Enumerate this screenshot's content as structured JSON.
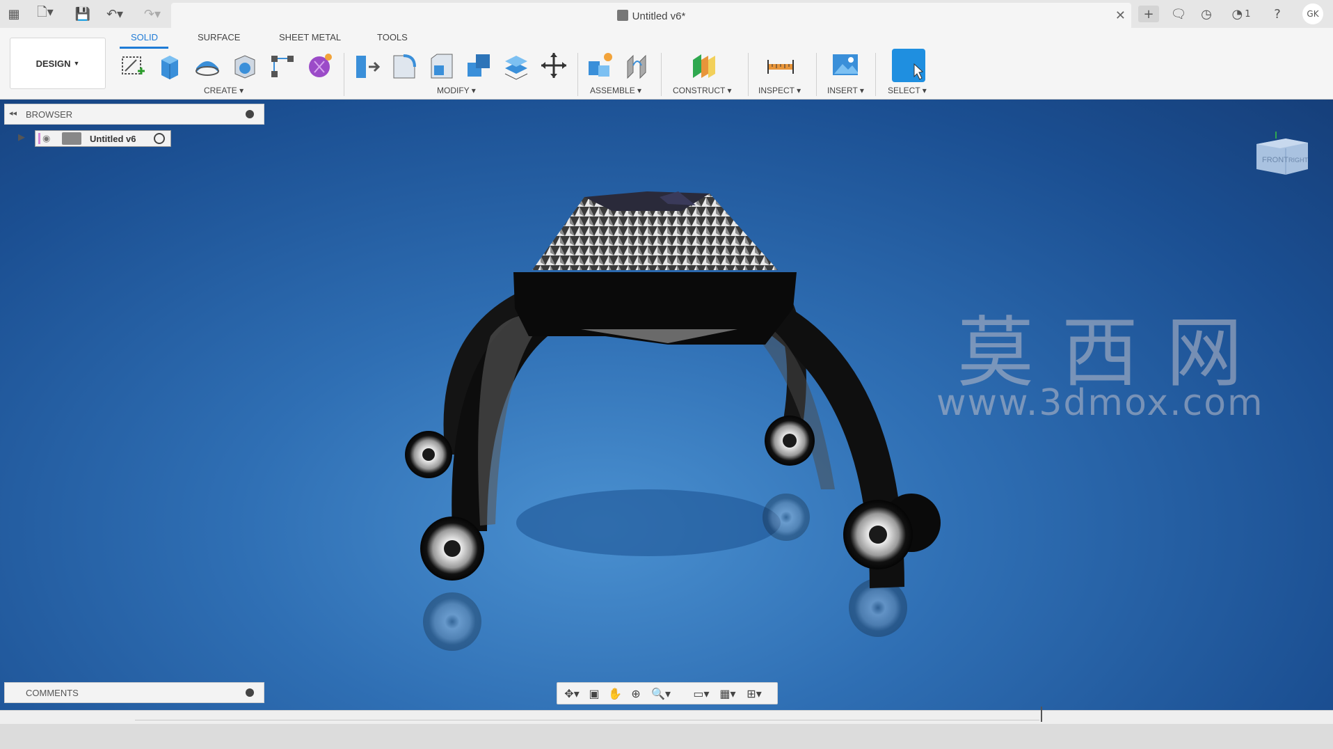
{
  "window": {
    "title": "Untitled v6*"
  },
  "toolbar": {
    "workspace": "DESIGN",
    "tabs": [
      "SOLID",
      "SURFACE",
      "SHEET METAL",
      "TOOLS"
    ],
    "groups": [
      "CREATE",
      "MODIFY",
      "ASSEMBLE",
      "CONSTRUCT",
      "INSPECT",
      "INSERT",
      "SELECT"
    ]
  },
  "header": {
    "jobs_count": "1",
    "user_initials": "GK"
  },
  "browser": {
    "title": "BROWSER",
    "root_component": "Untitled v6"
  },
  "comments": {
    "title": "COMMENTS"
  },
  "viewcube": {
    "front": "FRONT",
    "right": "RIGHT"
  },
  "watermark": {
    "cn": "莫西网",
    "url": "www.3dmox.com"
  },
  "colors": {
    "accent": "#1f7bd6",
    "viewport_bg": "#2f6fb4",
    "toolbar_bg": "#f5f5f5"
  }
}
